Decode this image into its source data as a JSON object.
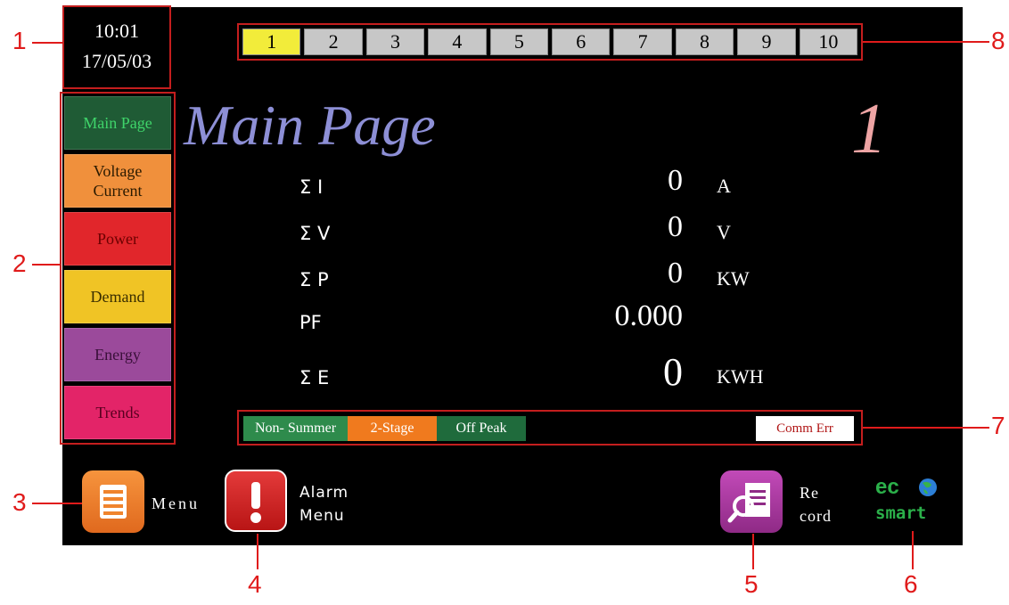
{
  "clock": {
    "time": "10:01",
    "date": "17/05/03"
  },
  "tabs": [
    "1",
    "2",
    "3",
    "4",
    "5",
    "6",
    "7",
    "8",
    "9",
    "10"
  ],
  "active_tab": "1",
  "nav": [
    {
      "label": "Main Page",
      "bg": "#1f5b35",
      "fg": "#3fd46a"
    },
    {
      "label": "Voltage\nCurrent",
      "bg": "#f0903c",
      "fg": "#2a1a00"
    },
    {
      "label": "Power",
      "bg": "#e1262b",
      "fg": "#6b0000"
    },
    {
      "label": "Demand",
      "bg": "#f0c425",
      "fg": "#3a2e00"
    },
    {
      "label": "Energy",
      "bg": "#9b4a9b",
      "fg": "#3a103a"
    },
    {
      "label": "Trends",
      "bg": "#e32468",
      "fg": "#5a0020"
    }
  ],
  "title": "Main Page",
  "page_number": "1",
  "readings": [
    {
      "label": "Σ I",
      "value": "0",
      "unit": "A"
    },
    {
      "label": "Σ V",
      "value": "0",
      "unit": "V"
    },
    {
      "label": "Σ P",
      "value": "0",
      "unit": "KW"
    },
    {
      "label": "PF",
      "value": "0.000",
      "unit": ""
    },
    {
      "label": "Σ E",
      "value": "0",
      "unit": "KWH"
    }
  ],
  "status": {
    "season": "Non- Summer",
    "stage": "2-Stage",
    "period": "Off Peak",
    "comm": "Comm Err"
  },
  "bottom": {
    "menu": "Menu",
    "alarm_line1": "Alarm",
    "alarm_line2": "Menu",
    "record_line1": "Re",
    "record_line2": "cord",
    "logo_top": "eco",
    "logo_bottom": "smart"
  },
  "callouts": [
    "1",
    "2",
    "3",
    "4",
    "5",
    "6",
    "7",
    "8"
  ],
  "colors": {
    "annotation": "#e01b1b",
    "title": "#8d8fd6",
    "page_number": "#eea4a4"
  }
}
